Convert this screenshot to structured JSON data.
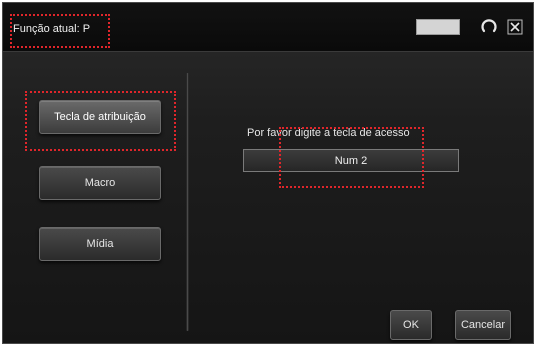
{
  "title": {
    "text": "Função atual: P"
  },
  "titlebar": {
    "swatch_color": "#d4d4d4",
    "refresh_icon": "refresh-icon",
    "close_icon": "close-icon"
  },
  "sidebar": {
    "items": [
      {
        "label": "Tecla de atribuição",
        "active": true
      },
      {
        "label": "Macro",
        "active": false
      },
      {
        "label": "Mídia",
        "active": false
      }
    ]
  },
  "main": {
    "prompt": "Por favor digite a tecla de acesso",
    "key_value": "Num 2"
  },
  "footer": {
    "ok_label": "OK",
    "cancel_label": "Cancelar"
  },
  "colors": {
    "highlight": "#e0262b",
    "background": "#1e1e1e",
    "text": "#e6e6e6"
  }
}
